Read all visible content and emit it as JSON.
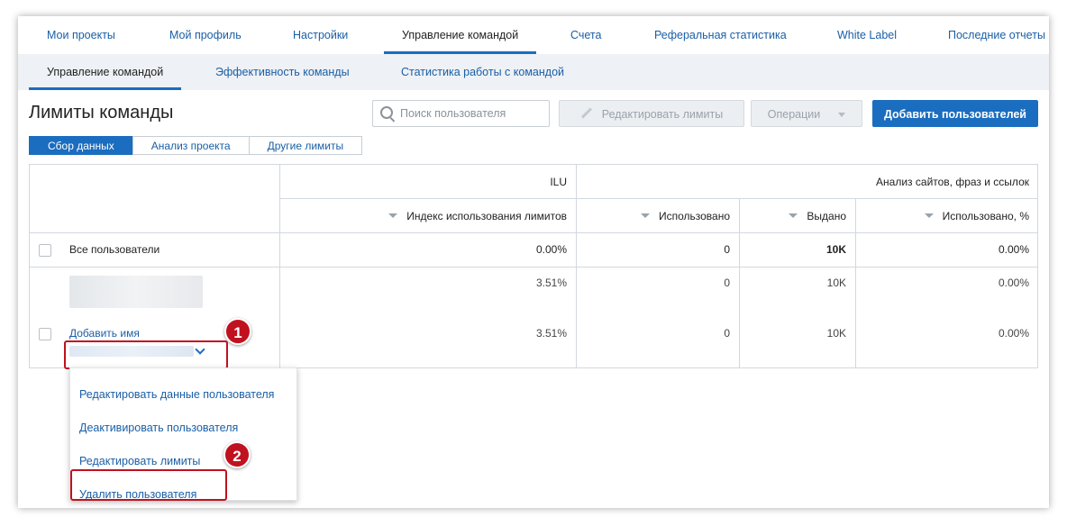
{
  "top_nav": {
    "tabs": [
      "Мои проекты",
      "Мой профиль",
      "Настройки",
      "Управление командой",
      "Счета",
      "Реферальная статистика",
      "White Label",
      "Последние отчеты"
    ],
    "active_tab": "Управление командой"
  },
  "sub_nav": {
    "tabs": [
      "Управление командой",
      "Эффективность команды",
      "Статистика работы с командой"
    ],
    "active_tab": "Управление командой"
  },
  "page": {
    "title": "Лимиты команды"
  },
  "toolbar": {
    "search_placeholder": "Поиск пользователя",
    "edit_limits_label": "Редактировать лимиты",
    "operations_label": "Операции",
    "add_users_label": "Добавить пользователей"
  },
  "segments": [
    "Сбор данных",
    "Анализ проекта",
    "Другие лимиты"
  ],
  "table": {
    "group_headers": {
      "ilu": "ILU",
      "analysis": "Анализ сайтов, фраз и ссылок"
    },
    "columns": [
      "Индекс использования лимитов",
      "Использовано",
      "Выдано",
      "Использовано, %"
    ],
    "all_users_row": {
      "label": "Все пользователи",
      "ilu": "0.00%",
      "used": "0",
      "issued": "10K",
      "used_pct": "0.00%"
    },
    "user_row": {
      "add_name_link": "Добавить имя",
      "line1": {
        "ilu": "3.51%",
        "used": "0",
        "issued": "10K",
        "used_pct": "0.00%"
      },
      "line2": {
        "ilu": "3.51%",
        "used": "0",
        "issued": "10K",
        "used_pct": "0.00%"
      }
    }
  },
  "dropdown": {
    "items": [
      "Редактировать данные пользователя",
      "Деактивировать пользователя",
      "Редактировать лимиты",
      "Удалить пользователя"
    ]
  },
  "callouts": [
    "1",
    "2"
  ],
  "colors": {
    "accent": "#1a6dbf",
    "link": "#1a5fa6",
    "callout": "#c0111f"
  }
}
